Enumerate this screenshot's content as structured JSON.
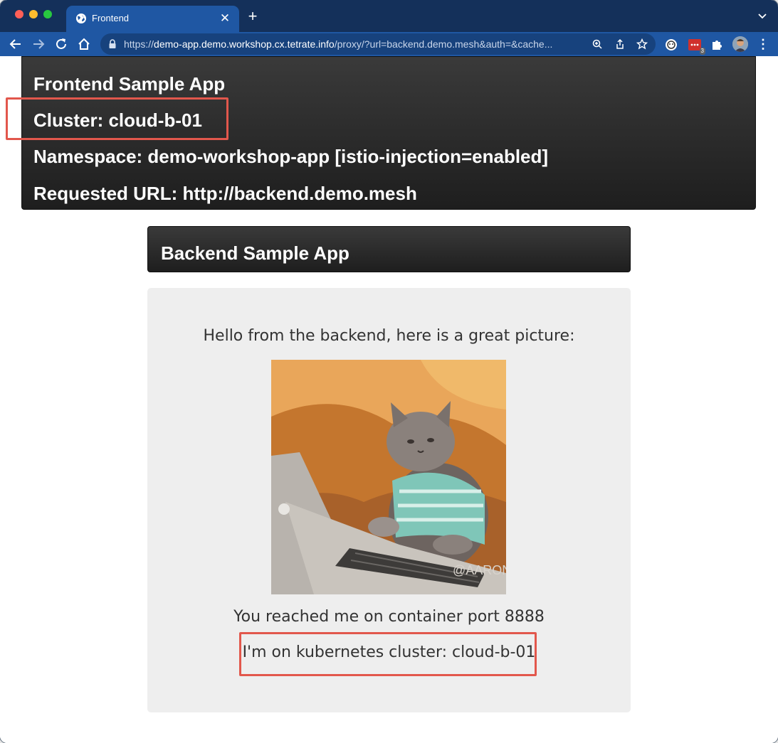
{
  "browser": {
    "tab": {
      "title": "Frontend"
    },
    "url": {
      "scheme": "https://",
      "host": "demo-app.demo.workshop.cx.tetrate.info",
      "path": "/proxy/?url=backend.demo.mesh&auth=&cache..."
    },
    "extensions": {
      "badge_count": "3"
    }
  },
  "frontend": {
    "title": "Frontend Sample App",
    "cluster": "Cluster: cloud-b-01",
    "namespace": "Namespace: demo-workshop-app [istio-injection=enabled]",
    "requested_url": "Requested URL: http://backend.demo.mesh"
  },
  "backend": {
    "title": "Backend Sample App",
    "greeting": "Hello from the backend, here is a great picture:",
    "image_watermark": "@AARON",
    "port_text": "You reached me on container port 8888",
    "cluster_text": "I'm on kubernetes cluster: cloud-b-01"
  },
  "colors": {
    "tabstrip": "#14305a",
    "toolbar": "#1f57a3",
    "panel_dark": "#2a2a2a",
    "highlight": "#e2574c",
    "backend_body": "#eeeeee"
  },
  "icons": [
    "globe-icon",
    "close-icon",
    "plus-icon",
    "chevron-down-icon",
    "back-icon",
    "forward-icon",
    "reload-icon",
    "home-icon",
    "lock-icon",
    "zoom-icon",
    "share-icon",
    "star-icon",
    "extension-icon",
    "puzzle-icon",
    "avatar",
    "kebab-menu-icon"
  ]
}
